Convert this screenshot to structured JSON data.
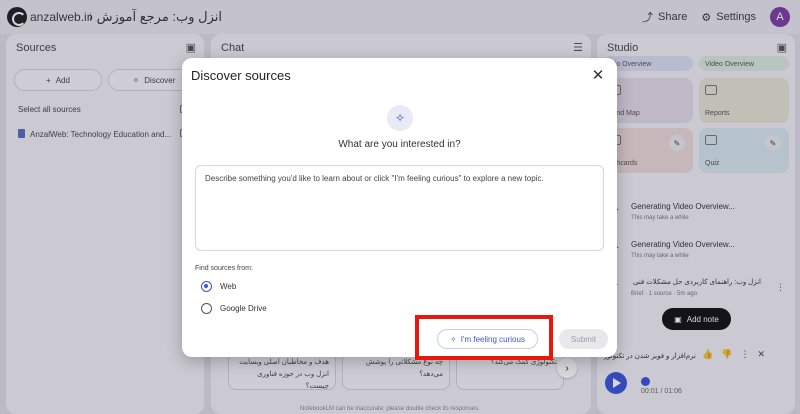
{
  "topbar": {
    "brand": "anzalweb.ir",
    "notebook_title": "انزل وب: مرجع آموزش فناوری و",
    "share_label": "Share",
    "settings_label": "Settings",
    "avatar_letter": "A"
  },
  "sources": {
    "title": "Sources",
    "add_label": "Add",
    "discover_label": "Discover",
    "select_all_label": "Select all sources",
    "items": [
      "AnzalWeb: Technology Education and..."
    ]
  },
  "chat": {
    "title": "Chat",
    "suggestions": [
      "هدف و مخاطبان اصلی وبسایت انزل وب در حوزه فناوری چیست؟",
      "چه نوع مشکلاتی را پوشش می‌دهد؟",
      "تکنولوژی کمک می‌کند؟"
    ],
    "footnote": "NotebookLM can be inaccurate; please double check its responses."
  },
  "studio": {
    "title": "Studio",
    "cards": [
      "udio Overview",
      "Video Overview",
      "Mind Map",
      "Reports",
      "ashcards",
      "Quiz"
    ],
    "generating": [
      {
        "title": "Generating Video Overview...",
        "subtitle": "This may take a while"
      },
      {
        "title": "Generating Video Overview...",
        "subtitle": "This may take a while"
      }
    ],
    "brief_title": "انزل وب: راهنمای کاربردی حل مشکلات فنی و",
    "brief_meta": "Brief · 1 source · 5m ago",
    "add_note_label": "Add note",
    "audio_title": "نرم‌افزار و فویز شدن در تکنولوژی",
    "audio_time": "00:01 / 01:06"
  },
  "modal": {
    "title": "Discover sources",
    "question": "What are you interested in?",
    "placeholder": "Describe something you'd like to learn about or click \"I'm feeling curious\" to explore a new topic.",
    "find_from_label": "Find sources from:",
    "options": [
      {
        "label": "Web",
        "selected": true
      },
      {
        "label": "Google Drive",
        "selected": false
      }
    ],
    "curious_label": "I'm feeling curious",
    "submit_label": "Submit"
  },
  "colors": {
    "accent": "#3a54d6",
    "highlight": "#e8180c"
  }
}
